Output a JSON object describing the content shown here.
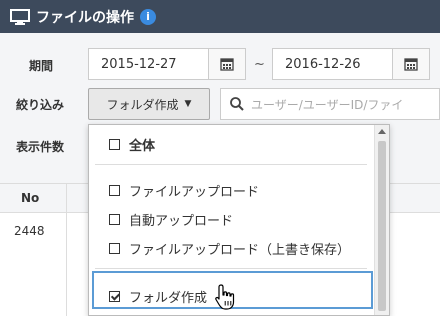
{
  "titlebar": {
    "title": "ファイルの操作",
    "info": "i",
    "icon": "monitor-icon"
  },
  "filters": {
    "period_label": "期間",
    "date_from": "2015-12-27",
    "tilde": "~",
    "date_to": "2016-12-26",
    "narrow_label": "絞り込み",
    "dropdown_label": "フォルダ作成",
    "search_placeholder": "ユーザー/ユーザーID/ファイ",
    "count_label": "表示件数"
  },
  "table": {
    "col_no": "No",
    "row1_no": "2448"
  },
  "menu": {
    "items": [
      {
        "label": "全体",
        "checked": false,
        "bold": true
      },
      {
        "label": "ファイルアップロード",
        "checked": false
      },
      {
        "label": "自動アップロード",
        "checked": false
      },
      {
        "label": "ファイルアップロード（上書き保存）",
        "checked": false
      },
      {
        "label": "フォルダ作成",
        "checked": true
      }
    ]
  },
  "colors": {
    "titlebar_bg": "#3d4a5c",
    "info_badge": "#3a8be0",
    "highlight": "#5b9bd5"
  }
}
